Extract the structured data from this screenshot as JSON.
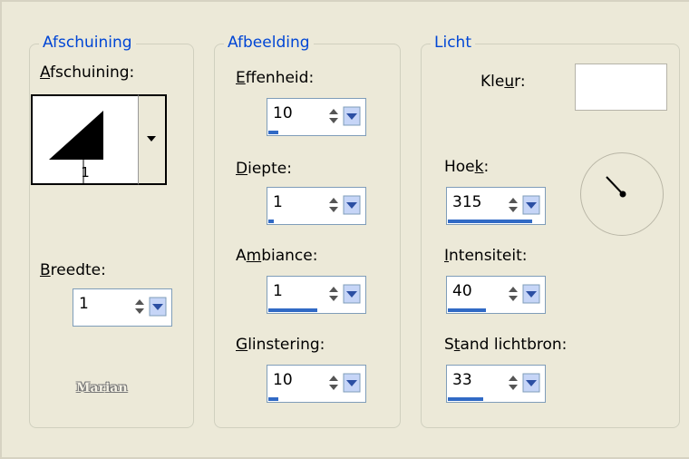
{
  "groups": {
    "bevel": {
      "title": "Afschuining"
    },
    "image": {
      "title": "Afbeelding"
    },
    "light": {
      "title": "Licht"
    }
  },
  "bevel": {
    "label_underline": "A",
    "label_rest": "fschuining:",
    "preview_number": "1",
    "width_label_underline": "B",
    "width_label_rest": "reedte:",
    "width_value": "1"
  },
  "image": {
    "smoothness": {
      "label_underline": "E",
      "label_rest": "ffenheid:",
      "value": "10",
      "level_percent": 10
    },
    "depth": {
      "label_underline": "D",
      "label_rest": "iepte:",
      "value": "1",
      "level_percent": 1
    },
    "ambience": {
      "label_before": "A",
      "label_underline": "m",
      "label_rest": "biance:",
      "value": "1",
      "level_percent": 51
    },
    "shine": {
      "label_underline": "G",
      "label_rest": "linstering:",
      "value": "10",
      "level_percent": 10
    }
  },
  "light": {
    "color_label_before": "Kle",
    "color_label_underline": "u",
    "color_label_rest": "r:",
    "color_value": "#ffffff",
    "angle": {
      "label_before": "Hoe",
      "label_underline": "k",
      "label_rest": ":",
      "value": "315",
      "level_percent": 88
    },
    "intensity": {
      "label_underline": "I",
      "label_rest": "ntensiteit:",
      "value": "40",
      "level_percent": 40
    },
    "elevation": {
      "label_before": "S",
      "label_underline": "t",
      "label_rest": "and lichtbron:",
      "value": "33",
      "level_percent": 37
    }
  },
  "watermark": "Marian",
  "colors": {
    "accent": "#316ac5",
    "group_title": "#0046d5",
    "background": "#ece9d8"
  },
  "icons": {
    "spin_arrows": "spinner-up-down-icon",
    "dropdown": "dropdown-arrow-icon",
    "preview": "bevel-triangle-icon"
  }
}
